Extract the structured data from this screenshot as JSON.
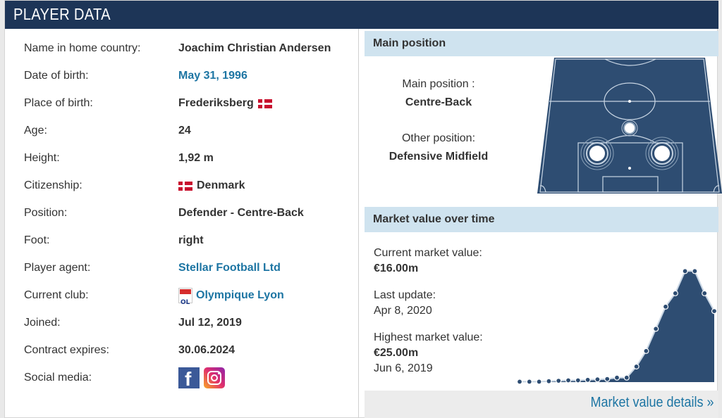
{
  "header": {
    "title": "PLAYER DATA"
  },
  "player": {
    "rows": [
      {
        "label": "Name in home country:",
        "value": "Joachim Christian Andersen"
      },
      {
        "label": "Date of birth:",
        "value": "May 31, 1996"
      },
      {
        "label": "Place of birth:",
        "value": "Frederiksberg"
      },
      {
        "label": "Age:",
        "value": "24"
      },
      {
        "label": "Height:",
        "value": "1,92 m"
      },
      {
        "label": "Citizenship:",
        "value": "Denmark"
      },
      {
        "label": "Position:",
        "value": "Defender - Centre-Back"
      },
      {
        "label": "Foot:",
        "value": "right"
      },
      {
        "label": "Player agent:",
        "value": "Stellar Football Ltd"
      },
      {
        "label": "Current club:",
        "value": "Olympique Lyon"
      },
      {
        "label": "Joined:",
        "value": "Jul 12, 2019"
      },
      {
        "label": "Contract expires:",
        "value": "30.06.2024"
      },
      {
        "label": "Social media:",
        "value": ""
      }
    ],
    "flag_icon": "denmark-flag-icon",
    "club_icon": "olympique-lyon-logo",
    "social_icons": [
      "facebook-icon",
      "instagram-icon"
    ]
  },
  "main_position": {
    "heading": "Main position",
    "main_label": "Main position :",
    "main_value": "Centre-Back",
    "other_label": "Other position:",
    "other_value": "Defensive Midfield"
  },
  "market_value": {
    "heading": "Market value over time",
    "current_label": "Current market value:",
    "current_value": "€16.00m",
    "update_label": "Last update:",
    "update_value": "Apr 8, 2020",
    "highest_label": "Highest market value:",
    "highest_value": "€25.00m",
    "highest_date": "Jun 6, 2019",
    "details_link": "Market value details »"
  },
  "colors": {
    "header": "#1d3557",
    "link": "#1d75a3",
    "section": "#cfe3ef",
    "pitch": "#2e4d72"
  },
  "chart_data": {
    "type": "area",
    "values": [
      0.1,
      0.1,
      0.1,
      0.2,
      0.3,
      0.4,
      0.4,
      0.5,
      0.6,
      0.7,
      1.0,
      1.0,
      3.5,
      7.0,
      12.0,
      17.0,
      20.0,
      25.0,
      25.0,
      20.0,
      16.0
    ],
    "ylim": [
      0,
      26
    ]
  }
}
